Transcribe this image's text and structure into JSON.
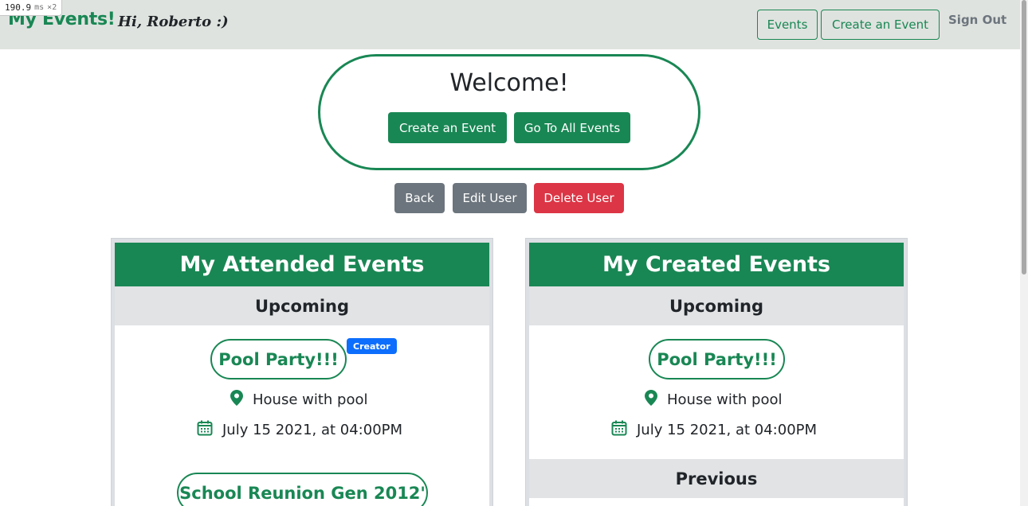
{
  "perf": {
    "value": "190.9",
    "unit": "ms",
    "multiplier": "×2"
  },
  "navbar": {
    "brand": "My Events!",
    "greeting": "Hi, Roberto :)",
    "events_label": "Events",
    "create_label": "Create an Event",
    "signout_label": "Sign Out"
  },
  "welcome": {
    "title": "Welcome!",
    "create_label": "Create an Event",
    "all_events_label": "Go To All Events"
  },
  "actions": {
    "back_label": "Back",
    "edit_label": "Edit User",
    "delete_label": "Delete User"
  },
  "attended": {
    "title": "My Attended Events",
    "upcoming_label": "Upcoming",
    "events": [
      {
        "name": "Pool Party!!!",
        "badge": "Creator",
        "location": "House with pool",
        "date": "July 15 2021, at 04:00PM"
      },
      {
        "name": "School Reunion Gen 2012'"
      }
    ]
  },
  "created": {
    "title": "My Created Events",
    "upcoming_label": "Upcoming",
    "previous_label": "Previous",
    "events": [
      {
        "name": "Pool Party!!!",
        "location": "House with pool",
        "date": "July 15 2021, at 04:00PM"
      }
    ]
  },
  "colors": {
    "primary_green": "#198754",
    "navbar_bg": "#dfe3df",
    "danger_red": "#dc3545",
    "secondary_gray": "#6c757d",
    "badge_blue": "#0d6efd"
  },
  "icons": [
    "map-pin-icon",
    "calendar-icon"
  ]
}
